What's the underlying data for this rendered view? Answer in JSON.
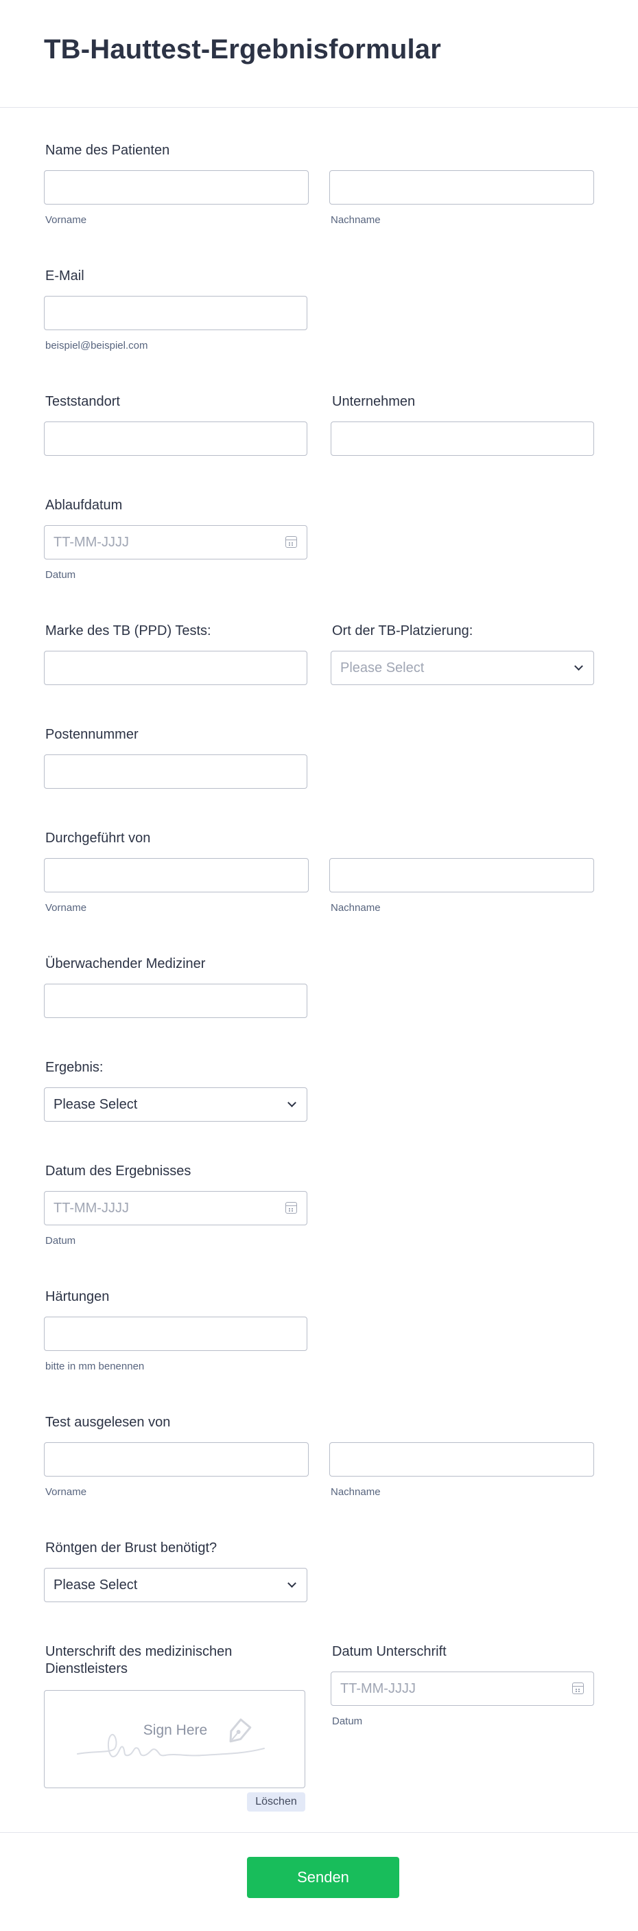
{
  "form": {
    "title": "TB-Hauttest-Ergebnisformular",
    "patient_name": {
      "label": "Name des Patienten",
      "first_sub": "Vorname",
      "last_sub": "Nachname"
    },
    "email": {
      "label": "E-Mail",
      "sub": "beispiel@beispiel.com"
    },
    "test_location": {
      "label": "Teststandort"
    },
    "company": {
      "label": "Unternehmen"
    },
    "expiry_date": {
      "label": "Ablaufdatum",
      "placeholder": "TT-MM-JJJJ",
      "sub": "Datum"
    },
    "ppd_brand": {
      "label": "Marke des TB (PPD) Tests:"
    },
    "placement_site": {
      "label": "Ort der TB-Platzierung:",
      "selected": "Please Select"
    },
    "lot_number": {
      "label": "Postennummer"
    },
    "performed_by": {
      "label": "Durchgeführt von",
      "first_sub": "Vorname",
      "last_sub": "Nachname"
    },
    "supervising_physician": {
      "label": "Überwachender Mediziner"
    },
    "result": {
      "label": "Ergebnis:",
      "selected": "Please Select"
    },
    "result_date": {
      "label": "Datum des Ergebnisses",
      "placeholder": "TT-MM-JJJJ",
      "sub": "Datum"
    },
    "induration": {
      "label": "Härtungen",
      "sub": "bitte in mm benennen"
    },
    "read_by": {
      "label": "Test ausgelesen von",
      "first_sub": "Vorname",
      "last_sub": "Nachname"
    },
    "chest_xray": {
      "label": "Röntgen der Brust benötigt?",
      "selected": "Please Select"
    },
    "signature": {
      "label_line1": "Unterschrift des medizinischen",
      "label_line2": "Dienstleisters",
      "prompt": "Sign Here",
      "clear_label": "Löschen"
    },
    "signature_date": {
      "label": "Datum Unterschrift",
      "placeholder": "TT-MM-JJJJ",
      "sub": "Datum"
    },
    "submit_label": "Senden"
  },
  "colors": {
    "submit": "#18bd5b",
    "border": "#b8bdc9",
    "text": "#2c3345",
    "sublabel": "#57647e"
  },
  "icons": [
    "calendar-icon",
    "chevron-down-icon",
    "pen-icon"
  ]
}
